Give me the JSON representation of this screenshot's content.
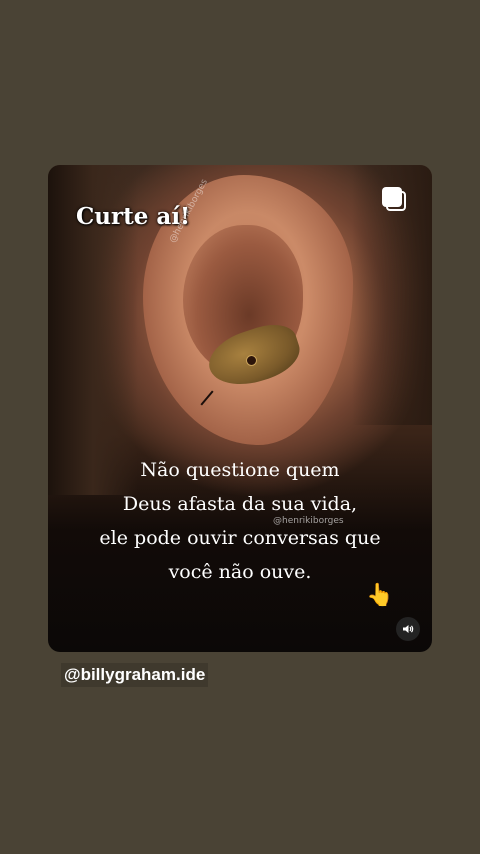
{
  "post": {
    "sticker_text": "Curte aí!",
    "watermark_top": "@henrikiborges",
    "watermark_mid": "@henrikiborges",
    "quote_lines": [
      "Não questione quem",
      "Deus afasta da sua vida,",
      "ele pode ouvir conversas que",
      "você não ouve."
    ],
    "multi_icon": "carousel-icon",
    "hand_icon": "pointing-hand-icon",
    "sound_icon": "speaker-icon"
  },
  "handle": "@billygraham.ide",
  "colors": {
    "background": "#4a4335",
    "text": "#ffffff"
  }
}
